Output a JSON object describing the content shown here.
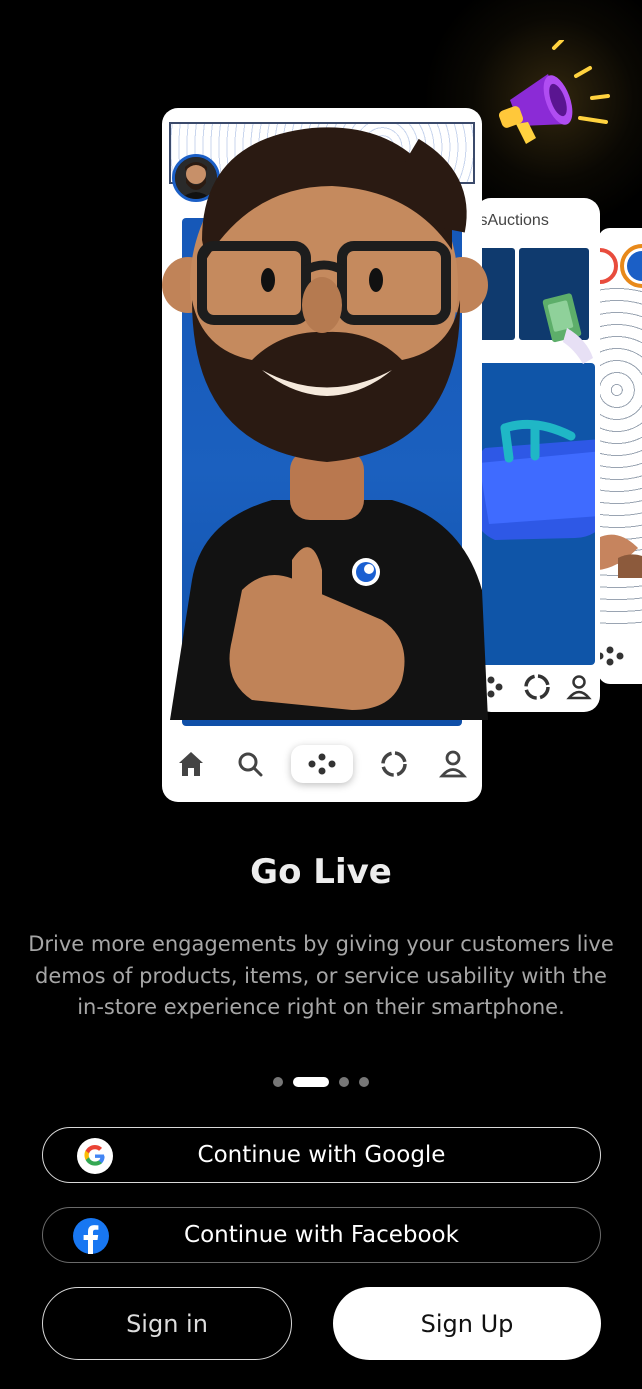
{
  "hero": {
    "tabs_label": "tsAuctions"
  },
  "onboarding": {
    "title": "Go Live",
    "description": "Drive more engagements by giving your customers live demos of products, items, or service usability with the in-store experience right on their smartphone.",
    "page_count": 4,
    "active_page": 2
  },
  "auth": {
    "google_label": "Continue with Google",
    "facebook_label": "Continue with Facebook",
    "signin_label": "Sign in",
    "signup_label": "Sign Up"
  },
  "icons": {
    "google": "google-icon",
    "facebook": "facebook-icon",
    "home": "home-icon",
    "search": "search-icon",
    "game": "gamepad-icon",
    "loading": "loading-ring-icon",
    "profile": "profile-icon",
    "megaphone": "megaphone-icon"
  },
  "colors": {
    "background": "#000000",
    "accent_blue": "#1658b8",
    "facebook_blue": "#1877f2",
    "primary_button": "#ffffff"
  }
}
